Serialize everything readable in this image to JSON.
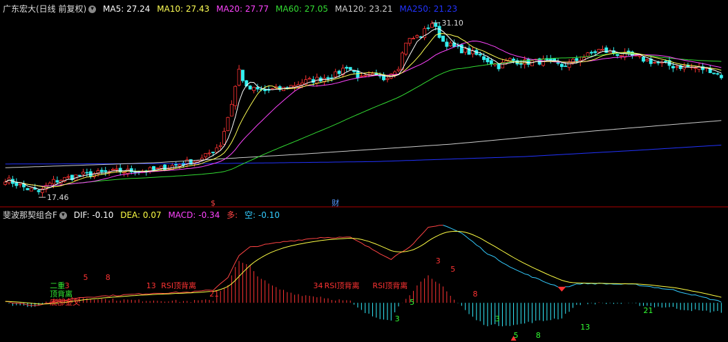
{
  "price_panel": {
    "stock_label": "广东宏大(日线 前复权)",
    "dropdown_glyph": "▾",
    "ma": [
      {
        "label": "MA5: 27.24",
        "color": "#ffffff"
      },
      {
        "label": "MA10: 27.43",
        "color": "#ffff55"
      },
      {
        "label": "MA20: 27.77",
        "color": "#ff44ff"
      },
      {
        "label": "MA60: 27.05",
        "color": "#33dd33"
      },
      {
        "label": "MA120: 23.21",
        "color": "#cccccc"
      },
      {
        "label": "MA250: 21.23",
        "color": "#2233ff"
      }
    ],
    "high_label": "31.10",
    "low_label": "17.46",
    "event_marks": [
      {
        "text": "$",
        "color": "#ff4444",
        "day": 56
      },
      {
        "text": "财",
        "color": "#5599ff",
        "day": 89
      }
    ]
  },
  "macd_panel": {
    "indicator_label": "斐波那契组合F",
    "dif_label": "DIF: -0.10",
    "dea_label": "DEA: 0.07",
    "macd_label": "MACD: -0.34",
    "long_label": "多:",
    "short_label": "空: -0.10",
    "colors": {
      "dif": "#33bbff",
      "dea": "#ffff44",
      "macd": "#ff44ff",
      "long": "#ff4444",
      "short": "#33ccff",
      "pos_bar": "#ff3333",
      "neg_bar": "#33eeff"
    },
    "annotations": [
      {
        "text": "二重",
        "color": "#33ee33",
        "day": 12,
        "row": 0
      },
      {
        "text": "顶背离",
        "color": "#33ee33",
        "day": 12,
        "row": 1
      },
      {
        "text": "底部金叉",
        "color": "#ff3333",
        "day": 12,
        "row": 2
      },
      {
        "text": "3",
        "color": "#ff3333",
        "day": 16,
        "row": 0
      },
      {
        "text": "5",
        "color": "#ff3333",
        "day": 21,
        "row": -1
      },
      {
        "text": "8",
        "color": "#ff3333",
        "day": 27,
        "row": -1
      },
      {
        "text": "13",
        "color": "#ff3333",
        "day": 38,
        "row": 0
      },
      {
        "text": "RSI顶背离",
        "color": "#ff3333",
        "day": 42,
        "row": 0
      },
      {
        "text": "21",
        "color": "#ff3333",
        "day": 55,
        "row": 1
      },
      {
        "text": "34",
        "color": "#ff3333",
        "day": 83,
        "row": 0
      },
      {
        "text": "RSI顶背离",
        "color": "#ff3333",
        "day": 86,
        "row": 0
      },
      {
        "text": "RSI顶背离",
        "color": "#ff3333",
        "day": 99,
        "row": 0
      },
      {
        "text": "3",
        "color": "#ff3333",
        "day": 116,
        "row": -3
      },
      {
        "text": "5",
        "color": "#ff3333",
        "day": 120,
        "row": -2
      },
      {
        "text": "8",
        "color": "#ff3333",
        "day": 126,
        "row": 1
      },
      {
        "text": "3",
        "color": "#33ff33",
        "day": 105,
        "row": 4
      },
      {
        "text": "5",
        "color": "#33ff33",
        "day": 109,
        "row": 2
      },
      {
        "text": "3",
        "color": "#33ff33",
        "day": 132,
        "row": 4
      },
      {
        "text": "5",
        "color": "#33ff33",
        "day": 137,
        "row": 6
      },
      {
        "text": "8",
        "color": "#33ff33",
        "day": 143,
        "row": 6
      },
      {
        "text": "13",
        "color": "#33ff33",
        "day": 155,
        "row": 5
      },
      {
        "text": "21",
        "color": "#33ff33",
        "day": 172,
        "row": 3
      }
    ]
  },
  "chart_data": {
    "type": "candlestick",
    "days": 194,
    "price_ylim": [
      16.8,
      31.6
    ],
    "macd_ylim": [
      -1.7,
      3.9
    ],
    "price_anchors": [
      [
        0,
        18.5
      ],
      [
        6,
        17.7
      ],
      [
        9,
        17.46
      ],
      [
        13,
        18.3
      ],
      [
        20,
        18.8
      ],
      [
        30,
        19.1
      ],
      [
        40,
        19.2
      ],
      [
        47,
        19.7
      ],
      [
        53,
        20.1
      ],
      [
        58,
        21.3
      ],
      [
        61,
        24.6
      ],
      [
        63,
        27.3
      ],
      [
        65,
        25.8
      ],
      [
        70,
        25.6
      ],
      [
        75,
        25.8
      ],
      [
        80,
        26.3
      ],
      [
        85,
        26.6
      ],
      [
        89,
        26.9
      ],
      [
        92,
        27.6
      ],
      [
        96,
        26.6
      ],
      [
        99,
        26.8
      ],
      [
        102,
        26.6
      ],
      [
        106,
        27.6
      ],
      [
        108,
        29.6
      ],
      [
        112,
        30.1
      ],
      [
        115,
        31.1
      ],
      [
        118,
        29.6
      ],
      [
        121,
        29.1
      ],
      [
        125,
        28.7
      ],
      [
        128,
        28.4
      ],
      [
        133,
        27.6
      ],
      [
        136,
        28.1
      ],
      [
        140,
        27.9
      ],
      [
        145,
        28.0
      ],
      [
        150,
        27.6
      ],
      [
        155,
        28.2
      ],
      [
        160,
        28.9
      ],
      [
        165,
        28.6
      ],
      [
        170,
        28.3
      ],
      [
        175,
        27.9
      ],
      [
        180,
        27.6
      ],
      [
        185,
        27.5
      ],
      [
        190,
        27.3
      ],
      [
        193,
        26.8
      ]
    ],
    "ma120_anchors": [
      [
        0,
        19.4
      ],
      [
        40,
        19.8
      ],
      [
        80,
        20.5
      ],
      [
        120,
        21.3
      ],
      [
        160,
        22.4
      ],
      [
        193,
        23.21
      ]
    ],
    "ma250_anchors": [
      [
        0,
        19.7
      ],
      [
        60,
        19.75
      ],
      [
        100,
        19.9
      ],
      [
        140,
        20.3
      ],
      [
        170,
        20.8
      ],
      [
        193,
        21.23
      ]
    ],
    "macd_anchors": [
      [
        0,
        0.05
      ],
      [
        8,
        -0.12
      ],
      [
        12,
        0.0
      ],
      [
        20,
        0.25
      ],
      [
        30,
        0.35
      ],
      [
        40,
        0.45
      ],
      [
        50,
        0.5
      ],
      [
        56,
        0.6
      ],
      [
        60,
        1.2
      ],
      [
        63,
        2.2
      ],
      [
        66,
        2.6
      ],
      [
        75,
        2.85
      ],
      [
        85,
        3.05
      ],
      [
        93,
        3.05
      ],
      [
        100,
        2.4
      ],
      [
        104,
        2.05
      ],
      [
        110,
        2.75
      ],
      [
        114,
        3.5
      ],
      [
        118,
        3.65
      ],
      [
        123,
        3.25
      ],
      [
        130,
        2.3
      ],
      [
        138,
        1.5
      ],
      [
        145,
        1.0
      ],
      [
        150,
        0.7
      ],
      [
        155,
        0.9
      ],
      [
        160,
        0.9
      ],
      [
        170,
        0.85
      ],
      [
        180,
        0.6
      ],
      [
        193,
        0.05
      ]
    ],
    "markers": {
      "high_day": 115,
      "low_day": 9,
      "red_diamond_day": 150,
      "red_triangle_day": 137
    }
  }
}
